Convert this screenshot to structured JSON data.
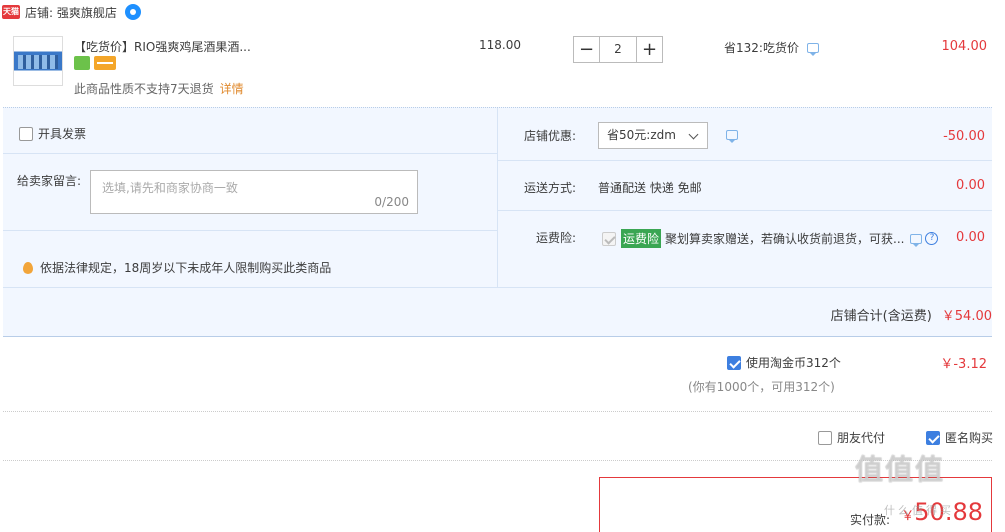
{
  "shop": {
    "badge": "天猫",
    "label": "店铺: 强爽旗舰店"
  },
  "item": {
    "title": "【吃货价】RIO强爽鸡尾酒果酒...",
    "return_note": "此商品性质不支持7天退货",
    "return_link": "详情",
    "unit_price": "118.00",
    "quantity": "2",
    "minus": "−",
    "plus": "+",
    "promo": "省132:吃货价",
    "total": "104.00"
  },
  "service": {
    "invoice_label": "开具发票",
    "message_label": "给卖家留言:",
    "message_placeholder": "选填,请先和商家协商一致",
    "message_count": "0/200",
    "legal_note": "依据法律规定，18周岁以下未成年人限制购买此类商品",
    "coupon_label": "店铺优惠:",
    "coupon_value": "省50元:zdm",
    "coupon_amount": "-50.00",
    "shipping_label": "运送方式:",
    "shipping_value": "普通配送 快递 免邮",
    "shipping_amount": "0.00",
    "insurance_label": "运费险:",
    "insurance_tag": "运费险",
    "insurance_text": "聚划算卖家赠送，若确认收货前退货，可获...",
    "insurance_amount": "0.00"
  },
  "shop_total": {
    "label": "店铺合计(含运费)",
    "amount": "￥54.00"
  },
  "coins": {
    "label": "使用淘金币312个",
    "amount": "￥-3.12",
    "sub": "(你有1000个，可用312个)"
  },
  "options": {
    "friend_pay": "朋友代付",
    "anonymous": "匿名购买"
  },
  "payment": {
    "label": "实付款:",
    "currency": "￥",
    "amount": "50.88"
  },
  "watermark": {
    "main": "值值值",
    "sub": "什么值得买"
  },
  "colors": {
    "accent_red": "#e4393c",
    "accent_blue": "#3d7fe0",
    "panel_bg": "#f2f7ff"
  }
}
